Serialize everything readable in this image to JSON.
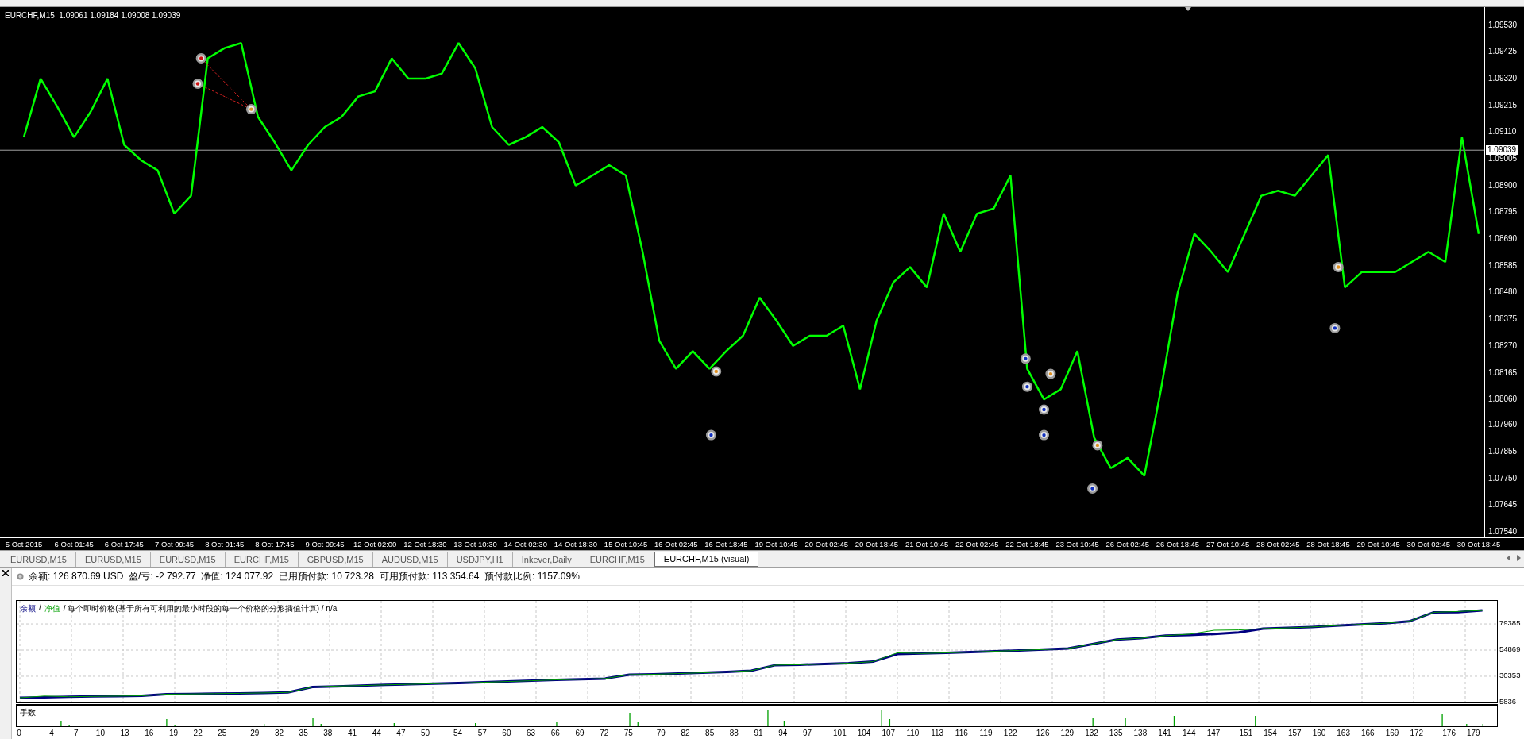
{
  "price_chart": {
    "header": "EURCHF,M15  1.09061 1.09184 1.09008 1.09039",
    "current_price": "1.09039",
    "chart_data": {
      "type": "line",
      "categories": [
        "5 Oct 2015",
        null,
        null,
        "6 Oct 01:45",
        null,
        null,
        "6 Oct 17:45",
        null,
        null,
        "7 Oct 09:45",
        null,
        null,
        "8 Oct 01:45",
        null,
        null,
        "8 Oct 17:45",
        null,
        null,
        "9 Oct 09:45",
        null,
        null,
        "12 Oct 02:00",
        null,
        null,
        "12 Oct 18:30",
        null,
        null,
        "13 Oct 10:30",
        null,
        null,
        "14 Oct 02:30",
        null,
        null,
        "14 Oct 18:30",
        null,
        null,
        "15 Oct 10:45",
        null,
        null,
        "16 Oct 02:45",
        null,
        null,
        "16 Oct 18:45",
        null,
        null,
        "19 Oct 10:45",
        null,
        null,
        "20 Oct 02:45",
        null,
        null,
        "20 Oct 18:45",
        null,
        null,
        "21 Oct 10:45",
        null,
        null,
        "22 Oct 02:45",
        null,
        null,
        "22 Oct 18:45",
        null,
        null,
        "23 Oct 10:45",
        null,
        null,
        "26 Oct 02:45",
        null,
        null,
        "26 Oct 18:45",
        null,
        null,
        "27 Oct 10:45",
        null,
        null,
        "28 Oct 02:45",
        null,
        null,
        "28 Oct 18:45",
        null,
        null,
        "29 Oct 10:45",
        null,
        null,
        "30 Oct 02:45",
        null,
        null,
        "30 Oct 18:45"
      ],
      "series": [
        {
          "color": "#00ff00",
          "values": [
            1.0909,
            1.0932,
            1.0921,
            1.0909,
            1.0919,
            1.0932,
            1.0906,
            1.09,
            1.0896,
            1.0879,
            1.0886,
            1.094,
            1.0944,
            1.0946,
            1.0917,
            1.0907,
            1.0896,
            1.0906,
            1.0913,
            1.0917,
            1.0925,
            1.0927,
            1.094,
            1.0932,
            1.0932,
            1.0934,
            1.0946,
            1.0936,
            1.0913,
            1.0906,
            1.0909,
            1.0913,
            1.0907,
            1.089,
            1.0894,
            1.0898,
            1.0894,
            1.0864,
            1.0829,
            1.0818,
            1.0825,
            1.0818,
            1.0825,
            1.0831,
            1.0846,
            1.0837,
            1.0827,
            1.0831,
            1.0831,
            1.0835,
            1.081,
            1.0837,
            1.0852,
            1.0858,
            1.085,
            1.0879,
            1.0864,
            1.0879,
            1.0881,
            1.0894,
            1.0818,
            1.0806,
            1.081,
            1.0825,
            1.0791,
            1.0779,
            1.0783,
            1.0776,
            1.081,
            1.0848,
            1.0871,
            1.0864,
            1.0856,
            1.0871,
            1.0886,
            1.0888,
            1.0886,
            1.0894,
            1.0902,
            1.085,
            1.0856,
            1.0856,
            1.0856,
            1.086,
            1.0864,
            1.086,
            1.0909,
            1.0871
          ]
        }
      ],
      "ylim": [
        1.07518,
        1.09601
      ],
      "ref_lines": [
        {
          "axis": "y",
          "value": 1.09039,
          "color": "#a0a0a0"
        }
      ],
      "yticks": [
        {
          "value": 1.0953,
          "label": "1.09530"
        },
        {
          "value": 1.09425,
          "label": "1.09425"
        },
        {
          "value": 1.0932,
          "label": "1.09320"
        },
        {
          "value": 1.09215,
          "label": "1.09215"
        },
        {
          "value": 1.0911,
          "label": "1.09110"
        },
        {
          "value": 1.09005,
          "label": "1.09005"
        },
        {
          "value": 1.089,
          "label": "1.08900"
        },
        {
          "value": 1.08795,
          "label": "1.08795"
        },
        {
          "value": 1.0869,
          "label": "1.08690"
        },
        {
          "value": 1.08585,
          "label": "1.08585"
        },
        {
          "value": 1.0848,
          "label": "1.08480"
        },
        {
          "value": 1.08375,
          "label": "1.08375"
        },
        {
          "value": 1.0827,
          "label": "1.08270"
        },
        {
          "value": 1.08165,
          "label": "1.08165"
        },
        {
          "value": 1.0806,
          "label": "1.08060"
        },
        {
          "value": 1.0796,
          "label": "1.07960"
        },
        {
          "value": 1.07855,
          "label": "1.07855"
        },
        {
          "value": 1.0775,
          "label": "1.07750"
        },
        {
          "value": 1.07645,
          "label": "1.07645"
        },
        {
          "value": 1.0754,
          "label": "1.07540"
        }
      ]
    }
  },
  "tabs": [
    {
      "label": "EURUSD,M15",
      "selected": false
    },
    {
      "label": "EURUSD,M15",
      "selected": false
    },
    {
      "label": "EURUSD,M15",
      "selected": false
    },
    {
      "label": "EURCHF,M15",
      "selected": false
    },
    {
      "label": "GBPUSD,M15",
      "selected": false
    },
    {
      "label": "AUDUSD,M15",
      "selected": false
    },
    {
      "label": "USDJPY,H1",
      "selected": false
    },
    {
      "label": "Inkever,Daily",
      "selected": false
    },
    {
      "label": "EURCHF,M15",
      "selected": false
    },
    {
      "label": "EURCHF,M15 (visual)",
      "selected": true
    }
  ],
  "status_bar": {
    "text": "余额: 126 870.69 USD  盈/亏: -2 792.77  净值: 124 077.92  已用预付款: 10 723.28  可用预付款: 113 354.64  预付款比例: 1157.09%"
  },
  "equity_chart": {
    "legend_separator": "/",
    "legend_note": "/ 每个即时价格(基于所有可利用的最小时段的每一个价格的分形插值计算) / n/a",
    "volume_label": "手数",
    "chart_data": {
      "type": "line",
      "x": [
        0,
        3,
        6,
        9,
        12,
        15,
        18,
        21,
        24,
        27,
        30,
        33,
        36,
        39,
        42,
        45,
        48,
        51,
        54,
        57,
        60,
        63,
        66,
        69,
        72,
        75,
        78,
        81,
        84,
        87,
        90,
        93,
        96,
        99,
        102,
        105,
        108,
        111,
        114,
        117,
        120,
        123,
        126,
        129,
        132,
        135,
        138,
        141,
        144,
        147,
        150,
        153,
        156,
        159,
        162,
        165,
        168,
        171,
        174,
        177,
        180
      ],
      "series": [
        {
          "name": "余额",
          "color": "#000080",
          "values": [
            10200,
            10700,
            11200,
            11500,
            11800,
            12100,
            13600,
            13800,
            14100,
            14400,
            14800,
            15200,
            20200,
            20800,
            21600,
            22300,
            22800,
            23400,
            24000,
            24700,
            25400,
            26200,
            27000,
            27600,
            28200,
            31800,
            32200,
            32900,
            33600,
            34400,
            35600,
            40800,
            41200,
            41800,
            42600,
            44000,
            51100,
            51700,
            52300,
            53000,
            53800,
            54600,
            55400,
            56400,
            60500,
            64700,
            66000,
            68400,
            69000,
            70000,
            71500,
            75000,
            75600,
            76500,
            77800,
            78900,
            80000,
            81800,
            90300,
            90400,
            92000
          ]
        },
        {
          "name": "净值",
          "color": "#00a000",
          "values": [
            10200,
            11900,
            11200,
            11500,
            11800,
            12100,
            13600,
            13800,
            14100,
            14400,
            14800,
            15200,
            20200,
            21200,
            21600,
            22300,
            22800,
            23400,
            24000,
            24700,
            25400,
            26200,
            27000,
            27600,
            28200,
            31800,
            32200,
            32900,
            33600,
            34400,
            35600,
            40800,
            41200,
            41800,
            42600,
            44000,
            52300,
            51700,
            52300,
            53000,
            53800,
            54600,
            55400,
            56400,
            60500,
            64700,
            66000,
            68400,
            69800,
            73500,
            73800,
            75000,
            75600,
            76500,
            77800,
            78900,
            80000,
            81800,
            90300,
            91000,
            92000
          ]
        }
      ],
      "grid": true,
      "xlim": [
        -0.4,
        181.8
      ],
      "ylim": [
        4300,
        101000
      ],
      "xticks": [
        0,
        4,
        7,
        10,
        13,
        16,
        19,
        22,
        25,
        29,
        32,
        35,
        38,
        41,
        44,
        47,
        50,
        54,
        57,
        60,
        63,
        66,
        69,
        72,
        75,
        79,
        82,
        85,
        88,
        91,
        94,
        97,
        101,
        104,
        107,
        110,
        113,
        116,
        119,
        122,
        126,
        129,
        132,
        135,
        138,
        141,
        144,
        147,
        151,
        154,
        157,
        160,
        163,
        166,
        169,
        172,
        176,
        179
      ],
      "yticks": [
        5836,
        30353,
        54869,
        79385
      ]
    }
  }
}
